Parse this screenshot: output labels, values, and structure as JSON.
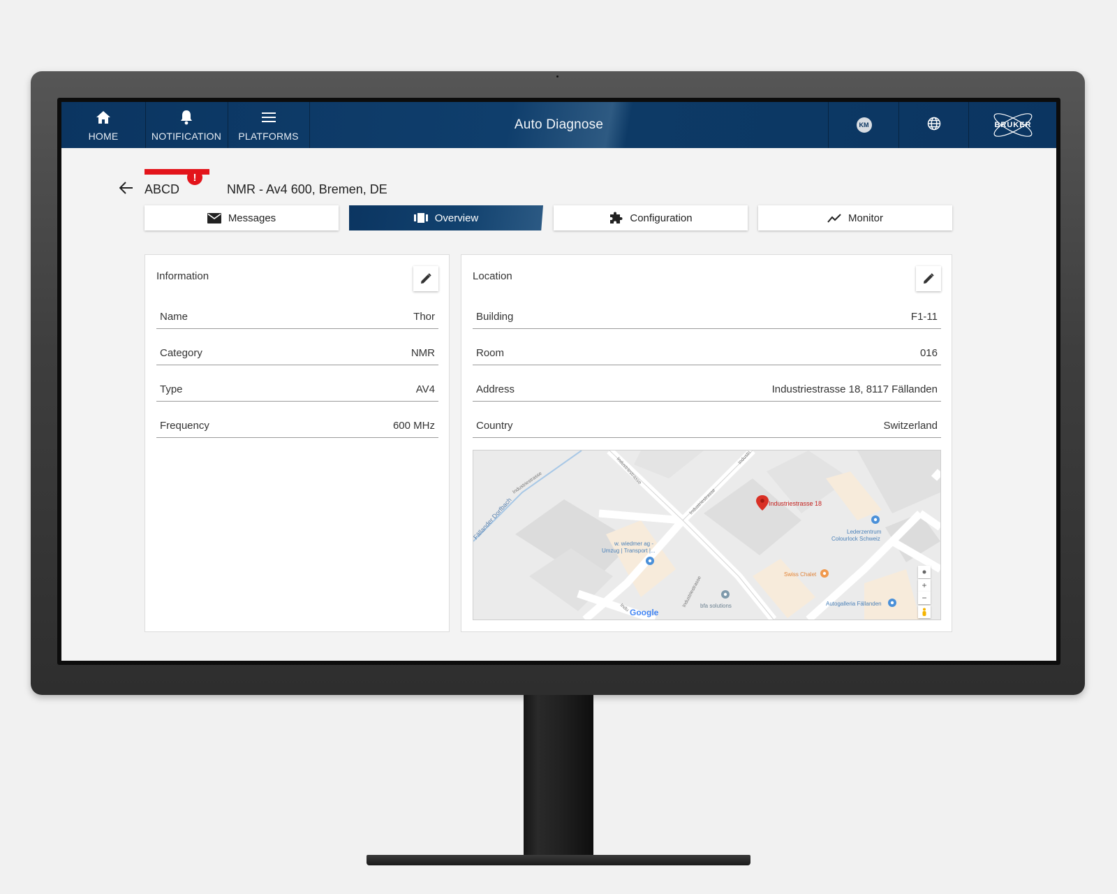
{
  "nav": {
    "home_label": "HOME",
    "notification_label": "NOTIFICATION",
    "platforms_label": "PLATFORMS",
    "app_title": "Auto Diagnose",
    "avatar_initials": "KM",
    "logo_text": "BRUKER"
  },
  "header": {
    "device_id": "ABCD",
    "alert_mark": "!",
    "device_desc": "NMR - Av4 600, Bremen, DE"
  },
  "tabs": [
    {
      "label": "Messages",
      "icon": "envelope-icon"
    },
    {
      "label": "Overview",
      "icon": "overview-icon",
      "active": true
    },
    {
      "label": "Configuration",
      "icon": "puzzle-icon"
    },
    {
      "label": "Monitor",
      "icon": "trend-line-icon"
    }
  ],
  "information": {
    "title": "Information",
    "rows": [
      {
        "label": "Name",
        "value": "Thor"
      },
      {
        "label": "Category",
        "value": "NMR"
      },
      {
        "label": "Type",
        "value": "AV4"
      },
      {
        "label": "Frequency",
        "value": "600 MHz"
      }
    ]
  },
  "location": {
    "title": "Location",
    "rows": [
      {
        "label": "Building",
        "value": "F1-11"
      },
      {
        "label": "Room",
        "value": "016"
      },
      {
        "label": "Address",
        "value": "Industriestrasse 18, 8117 Fällanden"
      },
      {
        "label": "Country",
        "value": "Switzerland"
      }
    ]
  },
  "map": {
    "pin_label": "Industriestrasse 18",
    "streets": [
      "Industriestrasse",
      "Industriestrasse",
      "Industriestrasse",
      "Industri",
      "Industriestrasse",
      "Fällander Dorfbach",
      "Indu"
    ],
    "poi_leder": [
      "Lederzentrum",
      "Colourlock Schweiz"
    ],
    "poi_wiedmer": [
      "w. wiedmer ag -",
      "Umzug | Transport |..."
    ],
    "poi_swiss_chalet": "Swiss Chalet",
    "poi_bfa": "bfa solutions",
    "poi_autogalleria": "Autogalleria Fällanden",
    "google_logo": "Google",
    "zoom_in": "+",
    "zoom_out": "−"
  },
  "colors": {
    "nav_blue": "#0b3561",
    "alert_red": "#e3141b"
  }
}
